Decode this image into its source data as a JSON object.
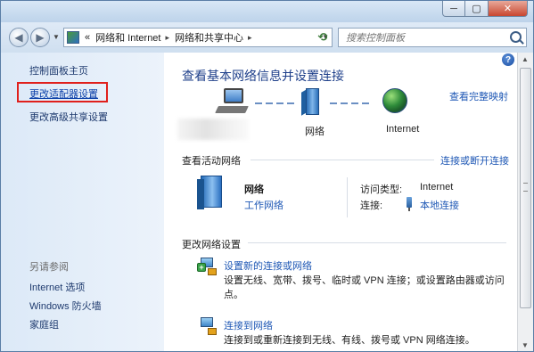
{
  "window": {
    "minimize": "─",
    "maximize": "▢",
    "close": "✕"
  },
  "address": {
    "back": "◀",
    "forward": "▶",
    "prefix": "«",
    "segments": [
      "网络和 Internet",
      "网络和共享中心"
    ],
    "separator": "▸"
  },
  "search": {
    "placeholder": "搜索控制面板"
  },
  "sidebar": {
    "items": [
      "控制面板主页",
      "更改适配器设置",
      "更改高级共享设置"
    ],
    "see_also_heading": "另请参阅",
    "see_also": [
      "Internet 选项",
      "Windows 防火墙",
      "家庭组"
    ]
  },
  "main": {
    "title": "查看基本网络信息并设置连接",
    "view_full_map": "查看完整映射",
    "map": {
      "network_label": "网络",
      "internet_label": "Internet"
    },
    "active_networks": {
      "heading": "查看活动网络",
      "connect_disconnect": "连接或断开连接",
      "name": "网络",
      "type": "工作网络",
      "access_type_label": "访问类型:",
      "access_type_value": "Internet",
      "connection_label": "连接:",
      "connection_value": "本地连接"
    },
    "change_settings": {
      "heading": "更改网络设置",
      "items": [
        {
          "title": "设置新的连接或网络",
          "desc_line1": "设置无线、宽带、拨号、临时或 VPN 连接；或设置路由器或访问",
          "desc_line2": "点。"
        },
        {
          "title": "连接到网络",
          "desc_line1": "连接到或重新连接到无线、有线、拨号或 VPN 网络连接。"
        }
      ]
    },
    "help": "?"
  },
  "colors": {
    "link": "#1f58b5",
    "title": "#1e3f8a",
    "highlight_box": "#e0201c",
    "sidebar_bg": "#dce9f7"
  }
}
